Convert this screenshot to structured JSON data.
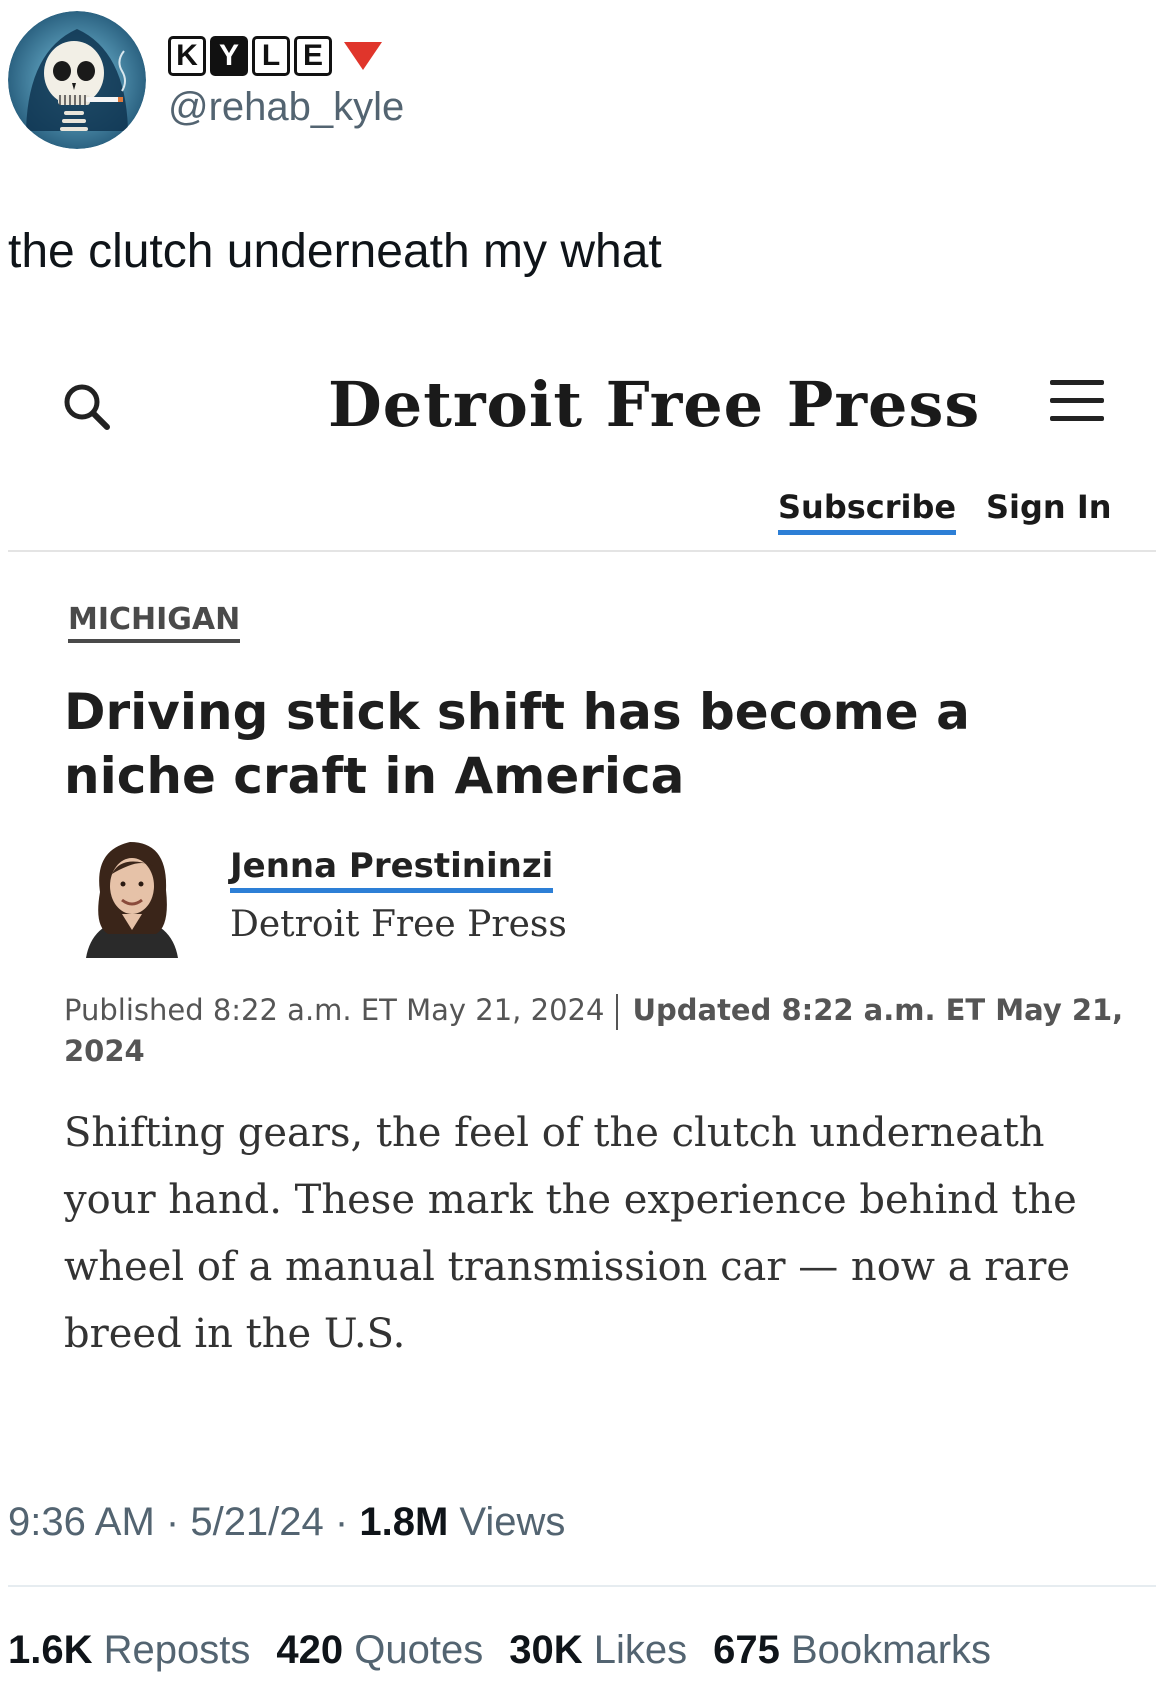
{
  "tweet": {
    "display_name_letters": [
      "K",
      "Y",
      "L",
      "E"
    ],
    "handle": "@rehab_kyle",
    "text": "the clutch underneath my what"
  },
  "article": {
    "masthead": "Detroit Free Press",
    "subscribe_label": "Subscribe",
    "signin_label": "Sign In",
    "section": "MICHIGAN",
    "headline": "Driving stick shift has become a niche craft in America",
    "author_name": "Jenna Prestininzi",
    "author_outlet": "Detroit Free Press",
    "published": "Published 8:22 a.m. ET May 21, 2024",
    "updated": "Updated 8:22 a.m. ET May 21, 2024",
    "lede": "Shifting gears, the feel of the clutch underneath your hand. These mark the experience behind the wheel of a manual transmission car — now a rare breed in the U.S."
  },
  "meta": {
    "time": "9:36 AM",
    "date": "5/21/24",
    "views_count": "1.8M",
    "views_label": "Views"
  },
  "stats": {
    "reposts_count": "1.6K",
    "reposts_label": "Reposts",
    "quotes_count": "420",
    "quotes_label": "Quotes",
    "likes_count": "30K",
    "likes_label": "Likes",
    "bookmarks_count": "675",
    "bookmarks_label": "Bookmarks"
  },
  "colors": {
    "link_underline": "#2d7fd6",
    "badge_triangle": "#e0352b",
    "secondary_text": "#536471",
    "primary_text": "#0f1419"
  },
  "icons": [
    "skull-avatar-icon",
    "red-triangle-icon",
    "search-icon",
    "menu-icon"
  ]
}
